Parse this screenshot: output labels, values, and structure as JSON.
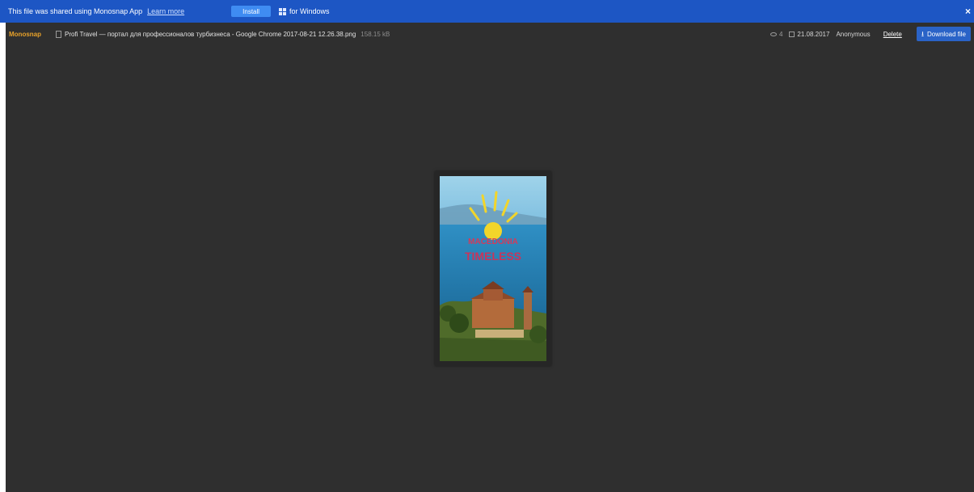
{
  "banner": {
    "message": "This file was shared using Monosnap App",
    "learn_more": "Learn more",
    "install_label": "Install",
    "platform_label": "for Windows",
    "close_label": "×"
  },
  "toolbar": {
    "brand": "Monosnap",
    "file_name": "Profi Travel — портал для профессионалов турбизнеса - Google Chrome 2017-08-21 12.26.38.png",
    "file_size": "158.15 kB",
    "views": "4",
    "date": "21.08.2017",
    "author": "Anonymous",
    "delete_label": "Delete",
    "download_label": "Download file"
  },
  "preview": {
    "text_line1": "MACEDONIA",
    "text_line2": "TIMELESS"
  },
  "colors": {
    "banner_bg": "#1d56c4",
    "viewer_bg": "#2f2f2f",
    "brand": "#e8a22a",
    "download_bg": "#2a63c7"
  },
  "icons": {
    "windows": "windows-icon",
    "file": "file-icon",
    "views": "eye-icon",
    "calendar": "calendar-icon",
    "download": "download-icon",
    "close": "close-icon"
  }
}
